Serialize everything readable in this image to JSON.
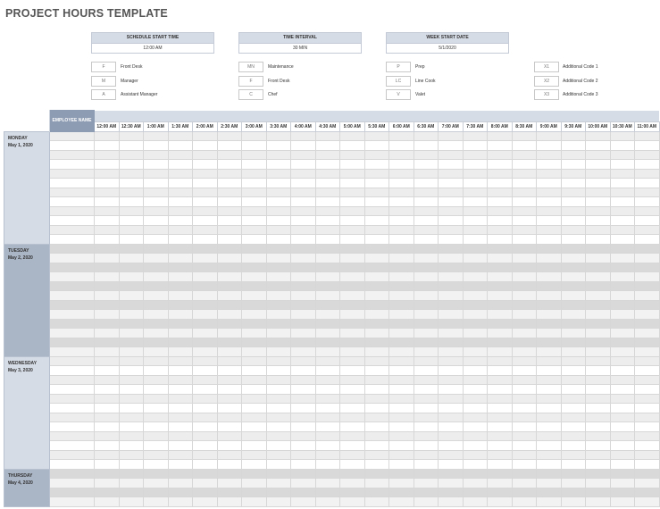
{
  "title": "PROJECT HOURS TEMPLATE",
  "settings": [
    {
      "label": "SCHEDULE START TIME",
      "value": "12:00 AM"
    },
    {
      "label": "TIME INTERVAL",
      "value": "30 MIN"
    },
    {
      "label": "WEEK START DATE",
      "value": "5/1/2020"
    }
  ],
  "codes": [
    {
      "code": "F",
      "label": "Front Desk"
    },
    {
      "code": "M",
      "label": "Manager"
    },
    {
      "code": "A",
      "label": "Assistant Manager"
    },
    {
      "code": "MN",
      "label": "Maintenance"
    },
    {
      "code": "F",
      "label": "Front Desk"
    },
    {
      "code": "C",
      "label": "Chef"
    },
    {
      "code": "P",
      "label": "Prep"
    },
    {
      "code": "LC",
      "label": "Line Cook"
    },
    {
      "code": "V",
      "label": "Valet"
    },
    {
      "code": "X1",
      "label": "Additional Code 1"
    },
    {
      "code": "X2",
      "label": "Additional Code 2"
    },
    {
      "code": "X3",
      "label": "Additional Code 3"
    }
  ],
  "table": {
    "employee_header": "EMPLOYEE NAME",
    "times": [
      "12:00 AM",
      "12:30 AM",
      "1:00 AM",
      "1:30 AM",
      "2:00 AM",
      "2:30 AM",
      "3:00 AM",
      "3:30 AM",
      "4:00 AM",
      "4:30 AM",
      "5:00 AM",
      "5:30 AM",
      "6:00 AM",
      "6:30 AM",
      "7:00 AM",
      "7:30 AM",
      "8:00 AM",
      "8:30 AM",
      "9:00 AM",
      "9:30 AM",
      "10:00 AM",
      "10:30 AM",
      "11:00 AM"
    ],
    "days": [
      {
        "day": "MONDAY",
        "date": "May 1, 2020"
      },
      {
        "day": "TUESDAY",
        "date": "May 2, 2020"
      },
      {
        "day": "WEDNESDAY",
        "date": "May 3, 2020"
      },
      {
        "day": "THURSDAY",
        "date": "May 4, 2020"
      }
    ]
  }
}
